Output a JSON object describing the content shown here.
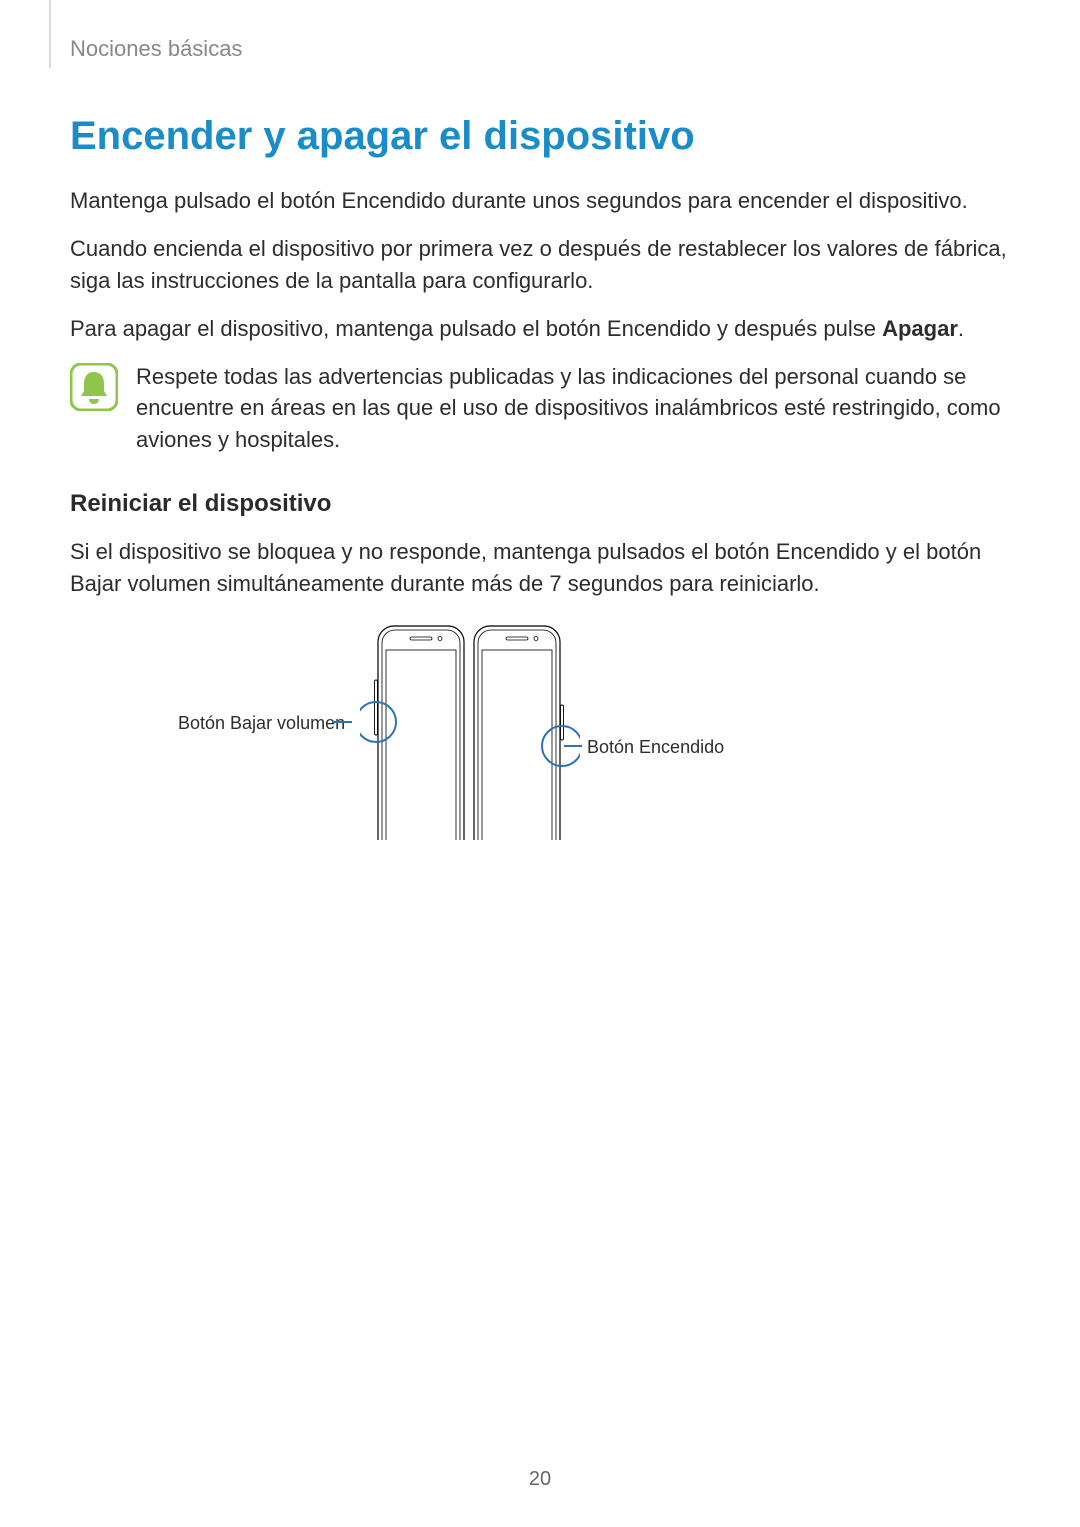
{
  "breadcrumb": "Nociones básicas",
  "title": "Encender y apagar el dispositivo",
  "para1": "Mantenga pulsado el botón Encendido durante unos segundos para encender el dispositivo.",
  "para2": "Cuando encienda el dispositivo por primera vez o después de restablecer los valores de fábrica, siga las instrucciones de la pantalla para configurarlo.",
  "para3_part1": "Para apagar el dispositivo, mantenga pulsado el botón Encendido y después pulse ",
  "para3_bold": "Apagar",
  "para3_part2": ".",
  "note": "Respete todas las advertencias publicadas y las indicaciones del personal cuando se encuentre en áreas en las que el uso de dispositivos inalámbricos esté restringido, como aviones y hospitales.",
  "subheading": "Reiniciar el dispositivo",
  "para4": "Si el dispositivo se bloquea y no responde, mantenga pulsados el botón Encendido y el botón Bajar volumen simultáneamente durante más de 7 segundos para reiniciarlo.",
  "diagram": {
    "label_left": "Botón Bajar volumen",
    "label_right": "Botón Encendido"
  },
  "page_number": "20",
  "icons": {
    "note": "bell-icon"
  },
  "colors": {
    "accent": "#1a8cc8",
    "note_icon_bg": "#8fc549",
    "circle": "#2a74b5"
  }
}
